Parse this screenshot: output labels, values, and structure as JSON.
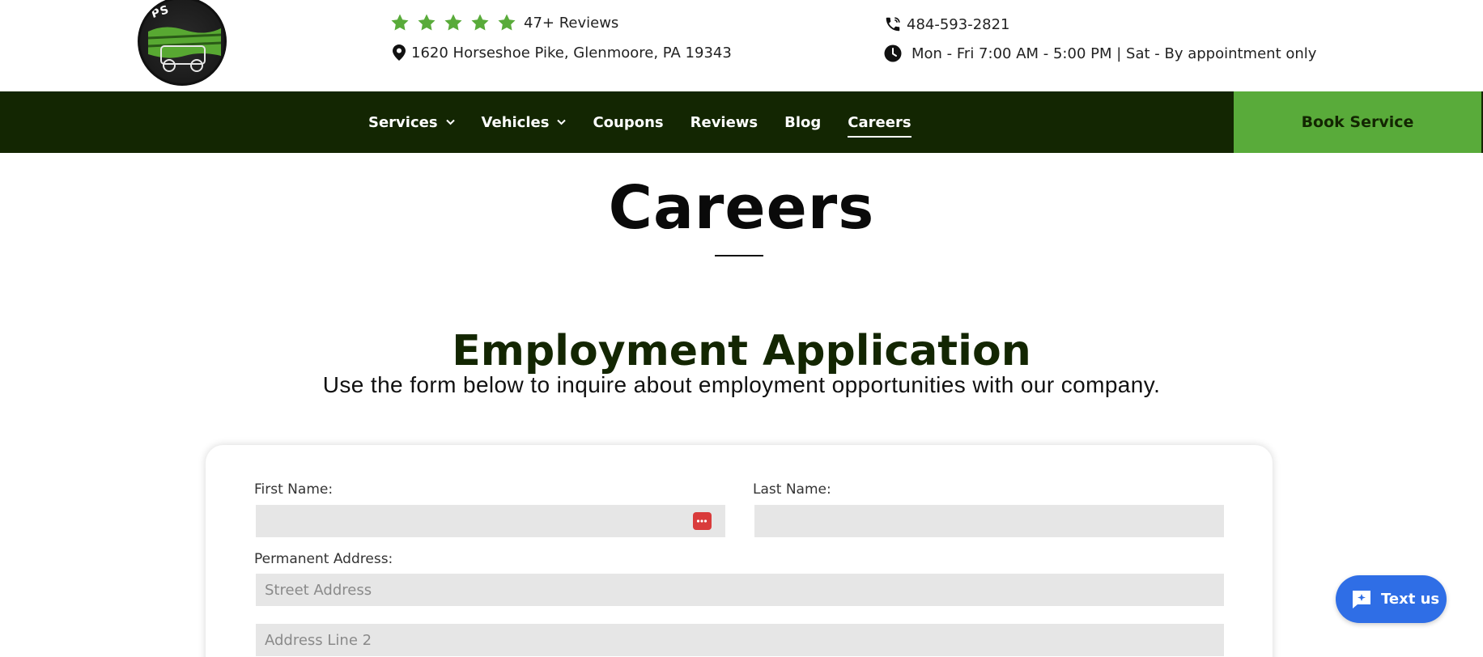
{
  "header": {
    "rating_text": "47+ Reviews",
    "address": "1620 Horseshoe Pike, Glenmoore, PA 19343",
    "phone": "484-593-2821",
    "hours": "Mon - Fri 7:00 AM - 5:00 PM | Sat - By appointment only",
    "star_color": "#59ab3a",
    "logo_letters": "PS"
  },
  "nav": {
    "items": [
      {
        "label": "Services",
        "has_dropdown": true
      },
      {
        "label": "Vehicles",
        "has_dropdown": true
      },
      {
        "label": "Coupons"
      },
      {
        "label": "Reviews"
      },
      {
        "label": "Blog"
      },
      {
        "label": "Careers",
        "active": true
      }
    ],
    "cta_label": "Book Service",
    "bar_color": "#132602",
    "cta_color": "#59ab3a"
  },
  "page": {
    "title": "Careers",
    "section_title": "Employment Application",
    "section_subtitle": "Use the form below to inquire about employment opportunities with our company."
  },
  "form": {
    "first_name_label": "First Name:",
    "last_name_label": "Last Name:",
    "address_label": "Permanent Address:",
    "street_placeholder": "Street Address",
    "line2_placeholder": "Address Line 2"
  },
  "widget": {
    "text_us_label": "Text us",
    "color": "#2f6ee6"
  }
}
